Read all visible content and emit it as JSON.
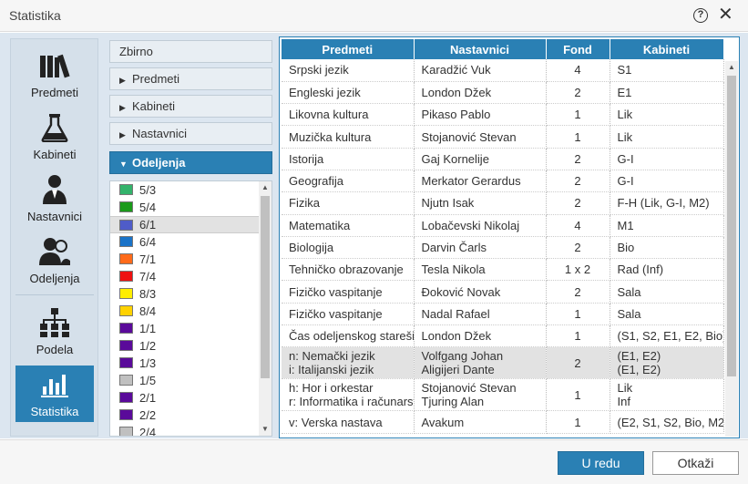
{
  "window": {
    "title": "Statistika"
  },
  "nav": [
    {
      "label": "Predmeti",
      "icon": "books-icon",
      "active": false
    },
    {
      "label": "Kabineti",
      "icon": "flask-icon",
      "active": false
    },
    {
      "label": "Nastavnici",
      "icon": "teacher-icon",
      "active": false
    },
    {
      "label": "Odeljenja",
      "icon": "students-icon",
      "active": false
    },
    {
      "label": "Podela",
      "icon": "hierarchy-icon",
      "active": false
    },
    {
      "label": "Statistika",
      "icon": "bar-chart-icon",
      "active": true
    }
  ],
  "accordion": [
    {
      "label": "Zbirno",
      "arrow": "",
      "active": false
    },
    {
      "label": "Predmeti",
      "arrow": "▶",
      "active": false
    },
    {
      "label": "Kabineti",
      "arrow": "▶",
      "active": false
    },
    {
      "label": "Nastavnici",
      "arrow": "▶",
      "active": false
    },
    {
      "label": "Odeljenja",
      "arrow": "▼",
      "active": true
    }
  ],
  "classes": [
    {
      "label": "5/3",
      "color": "#33b36b",
      "selected": false
    },
    {
      "label": "5/4",
      "color": "#1a9a1a",
      "selected": false
    },
    {
      "label": "6/1",
      "color": "#4f5cc8",
      "selected": true
    },
    {
      "label": "6/4",
      "color": "#1a73c8",
      "selected": false
    },
    {
      "label": "7/1",
      "color": "#ff6a1a",
      "selected": false
    },
    {
      "label": "7/4",
      "color": "#ee1111",
      "selected": false
    },
    {
      "label": "8/3",
      "color": "#ffee00",
      "selected": false
    },
    {
      "label": "8/4",
      "color": "#ffd200",
      "selected": false
    },
    {
      "label": "1/1",
      "color": "#5a0a9a",
      "selected": false
    },
    {
      "label": "1/2",
      "color": "#5a0a9a",
      "selected": false
    },
    {
      "label": "1/3",
      "color": "#5a0a9a",
      "selected": false
    },
    {
      "label": "1/5",
      "color": "#c0c0c0",
      "selected": false
    },
    {
      "label": "2/1",
      "color": "#5a0a9a",
      "selected": false
    },
    {
      "label": "2/2",
      "color": "#5a0a9a",
      "selected": false
    },
    {
      "label": "2/4",
      "color": "#c0c0c0",
      "selected": false
    }
  ],
  "table": {
    "headers": [
      "Predmeti",
      "Nastavnici",
      "Fond",
      "Kabineti"
    ],
    "rows": [
      {
        "predmet": [
          "Srpski jezik"
        ],
        "nastavnik": [
          "Karadžić Vuk"
        ],
        "fond": "4",
        "kabinet": [
          "S1"
        ]
      },
      {
        "predmet": [
          "Engleski jezik"
        ],
        "nastavnik": [
          "London Džek"
        ],
        "fond": "2",
        "kabinet": [
          "E1"
        ]
      },
      {
        "predmet": [
          "Likovna kultura"
        ],
        "nastavnik": [
          "Pikaso Pablo"
        ],
        "fond": "1",
        "kabinet": [
          "Lik"
        ]
      },
      {
        "predmet": [
          "Muzička kultura"
        ],
        "nastavnik": [
          "Stojanović Stevan"
        ],
        "fond": "1",
        "kabinet": [
          "Lik"
        ]
      },
      {
        "predmet": [
          "Istorija"
        ],
        "nastavnik": [
          "Gaj Kornelije"
        ],
        "fond": "2",
        "kabinet": [
          "G-I"
        ]
      },
      {
        "predmet": [
          "Geografija"
        ],
        "nastavnik": [
          "Merkator Gerardus"
        ],
        "fond": "2",
        "kabinet": [
          "G-I"
        ]
      },
      {
        "predmet": [
          "Fizika"
        ],
        "nastavnik": [
          "Njutn Isak"
        ],
        "fond": "2",
        "kabinet": [
          "F-H (Lik, G-I, M2)"
        ]
      },
      {
        "predmet": [
          "Matematika"
        ],
        "nastavnik": [
          "Lobačevski Nikolaj"
        ],
        "fond": "4",
        "kabinet": [
          "M1"
        ]
      },
      {
        "predmet": [
          "Biologija"
        ],
        "nastavnik": [
          "Darvin Čarls"
        ],
        "fond": "2",
        "kabinet": [
          "Bio"
        ]
      },
      {
        "predmet": [
          "Tehničko obrazovanje"
        ],
        "nastavnik": [
          "Tesla Nikola"
        ],
        "fond": "1 x 2",
        "kabinet": [
          "Rad (Inf)"
        ]
      },
      {
        "predmet": [
          "Fizičko vaspitanje"
        ],
        "nastavnik": [
          "Đoković Novak"
        ],
        "fond": "2",
        "kabinet": [
          "Sala"
        ]
      },
      {
        "predmet": [
          "Fizičko vaspitanje"
        ],
        "nastavnik": [
          "Nadal Rafael"
        ],
        "fond": "1",
        "kabinet": [
          "Sala"
        ]
      },
      {
        "predmet": [
          "Čas odeljenskog starešine"
        ],
        "nastavnik": [
          "London Džek"
        ],
        "fond": "1",
        "kabinet": [
          "(S1, S2, E1, E2, Bio)"
        ]
      },
      {
        "predmet": [
          "n:  Nemački jezik",
          "i:  Italijanski jezik"
        ],
        "nastavnik": [
          "Volfgang Johan",
          "Aligijeri Dante"
        ],
        "fond": "2",
        "kabinet": [
          "(E1, E2)",
          "(E1, E2)"
        ],
        "selected": true
      },
      {
        "predmet": [
          "h:  Hor i orkestar",
          "r:  Informatika i računarstvo"
        ],
        "nastavnik": [
          "Stojanović Stevan",
          "Tjuring Alan"
        ],
        "fond": "1",
        "kabinet": [
          "Lik",
          "Inf"
        ]
      },
      {
        "predmet": [
          "v:  Verska nastava"
        ],
        "nastavnik": [
          "Avakum"
        ],
        "fond": "1",
        "kabinet": [
          "(E2, S1, S2, Bio, M2)"
        ]
      }
    ]
  },
  "footer": {
    "ok_label": "U redu",
    "cancel_label": "Otkaži"
  }
}
